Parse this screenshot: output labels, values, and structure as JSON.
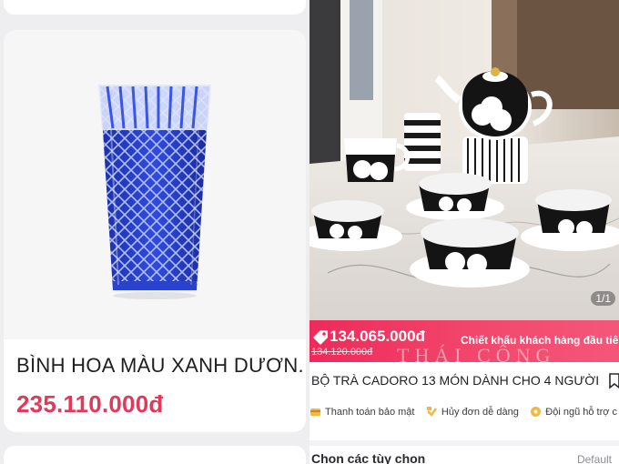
{
  "left_panel": {
    "product": {
      "title": "BÌNH HOA MÀU XANH DƯƠN...",
      "price": "235.110.000đ",
      "image_icon": "blue-crystal-vase-image"
    }
  },
  "right_panel": {
    "gallery": {
      "counter": "1/1",
      "image_icon": "tea-set-photo"
    },
    "price_band": {
      "price": "134.065.000đ",
      "original_price": "134.120.000đ",
      "discount_note": "Chiết khấu khách hàng đầu tiên",
      "watermark": "THÁI CÔNG"
    },
    "product_name": "BỘ TRÀ CADORO 13 MÓN DÀNH CHO 4 NGƯỜI",
    "perks": [
      {
        "label": "Thanh toán bảo mật",
        "icon": "secure-payment-icon"
      },
      {
        "label": "Hủy đơn dễ dàng",
        "icon": "easy-cancel-icon"
      },
      {
        "label": "Đội ngũ hỗ trợ c",
        "icon": "support-team-icon"
      }
    ],
    "options": {
      "label": "Chọn các tùy chọn",
      "value": "Default"
    },
    "colors": {
      "accent": "#ee2a5a",
      "price_text": "#e0395a"
    }
  }
}
